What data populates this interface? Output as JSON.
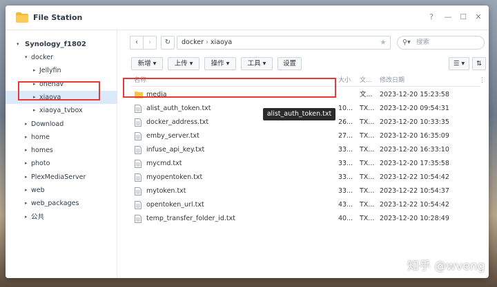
{
  "window": {
    "title": "File Station",
    "controls": [
      "?",
      "—",
      "☐",
      "✕"
    ]
  },
  "sidebar": {
    "root": "Synology_f1802",
    "items": [
      {
        "label": "docker",
        "caret": "▾",
        "indent": 1
      },
      {
        "label": "Jellyfin",
        "caret": "▸",
        "indent": 2
      },
      {
        "label": "onenav",
        "caret": "▸",
        "indent": 2
      },
      {
        "label": "xiaoya",
        "caret": "▸",
        "indent": 2,
        "selected": true
      },
      {
        "label": "xiaoya_tvbox",
        "caret": "▸",
        "indent": 2
      },
      {
        "label": "Download",
        "caret": "▸",
        "indent": 1
      },
      {
        "label": "home",
        "caret": "▸",
        "indent": 1
      },
      {
        "label": "homes",
        "caret": "▸",
        "indent": 1
      },
      {
        "label": "photo",
        "caret": "▸",
        "indent": 1
      },
      {
        "label": "PlexMediaServer",
        "caret": "▸",
        "indent": 1
      },
      {
        "label": "web",
        "caret": "▸",
        "indent": 1
      },
      {
        "label": "web_packages",
        "caret": "▸",
        "indent": 1
      },
      {
        "label": "公共",
        "caret": "▸",
        "indent": 1
      }
    ]
  },
  "nav": {
    "back": "‹",
    "forward": "›",
    "refresh": "↻",
    "path": [
      "docker",
      "xiaoya"
    ],
    "path_sep": "›",
    "search_placeholder": "搜索"
  },
  "toolbar": {
    "new": "新增 ▾",
    "upload": "上传 ▾",
    "action": "操作 ▾",
    "tools": "工具 ▾",
    "settings": "设置"
  },
  "columns": {
    "name": "名称",
    "size": "大小",
    "type": "文...",
    "modified": "修改日期"
  },
  "files": [
    {
      "name": "media",
      "size": "",
      "type": "文...",
      "modified": "2023-12-20 15:23:58",
      "kind": "folder"
    },
    {
      "name": "alist_auth_token.txt",
      "size": "10...",
      "type": "TX...",
      "modified": "2023-12-20 09:54:31",
      "kind": "file"
    },
    {
      "name": "docker_address.txt",
      "size": "26...",
      "type": "TX...",
      "modified": "2023-12-20 10:33:35",
      "kind": "file"
    },
    {
      "name": "emby_server.txt",
      "size": "27...",
      "type": "TX...",
      "modified": "2023-12-20 16:35:09",
      "kind": "file"
    },
    {
      "name": "infuse_api_key.txt",
      "size": "33...",
      "type": "TX...",
      "modified": "2023-12-20 16:33:10",
      "kind": "file"
    },
    {
      "name": "mycmd.txt",
      "size": "33...",
      "type": "TX...",
      "modified": "2023-12-20 17:35:58",
      "kind": "file"
    },
    {
      "name": "myopentoken.txt",
      "size": "33...",
      "type": "TX...",
      "modified": "2023-12-22 10:54:42",
      "kind": "file"
    },
    {
      "name": "mytoken.txt",
      "size": "33...",
      "type": "TX...",
      "modified": "2023-12-22 10:54:37",
      "kind": "file"
    },
    {
      "name": "opentoken_url.txt",
      "size": "43...",
      "type": "TX...",
      "modified": "2023-12-22 10:54:42",
      "kind": "file"
    },
    {
      "name": "temp_transfer_folder_id.txt",
      "size": "40...",
      "type": "TX...",
      "modified": "2023-12-20 10:28:49",
      "kind": "file"
    }
  ],
  "tooltip": "alist_auth_token.txt",
  "watermark": {
    "text": "知乎 @wveng"
  },
  "colors": {
    "accent": "#dbe9fb",
    "highlight": "#e53935",
    "folder": "#f5c542"
  }
}
